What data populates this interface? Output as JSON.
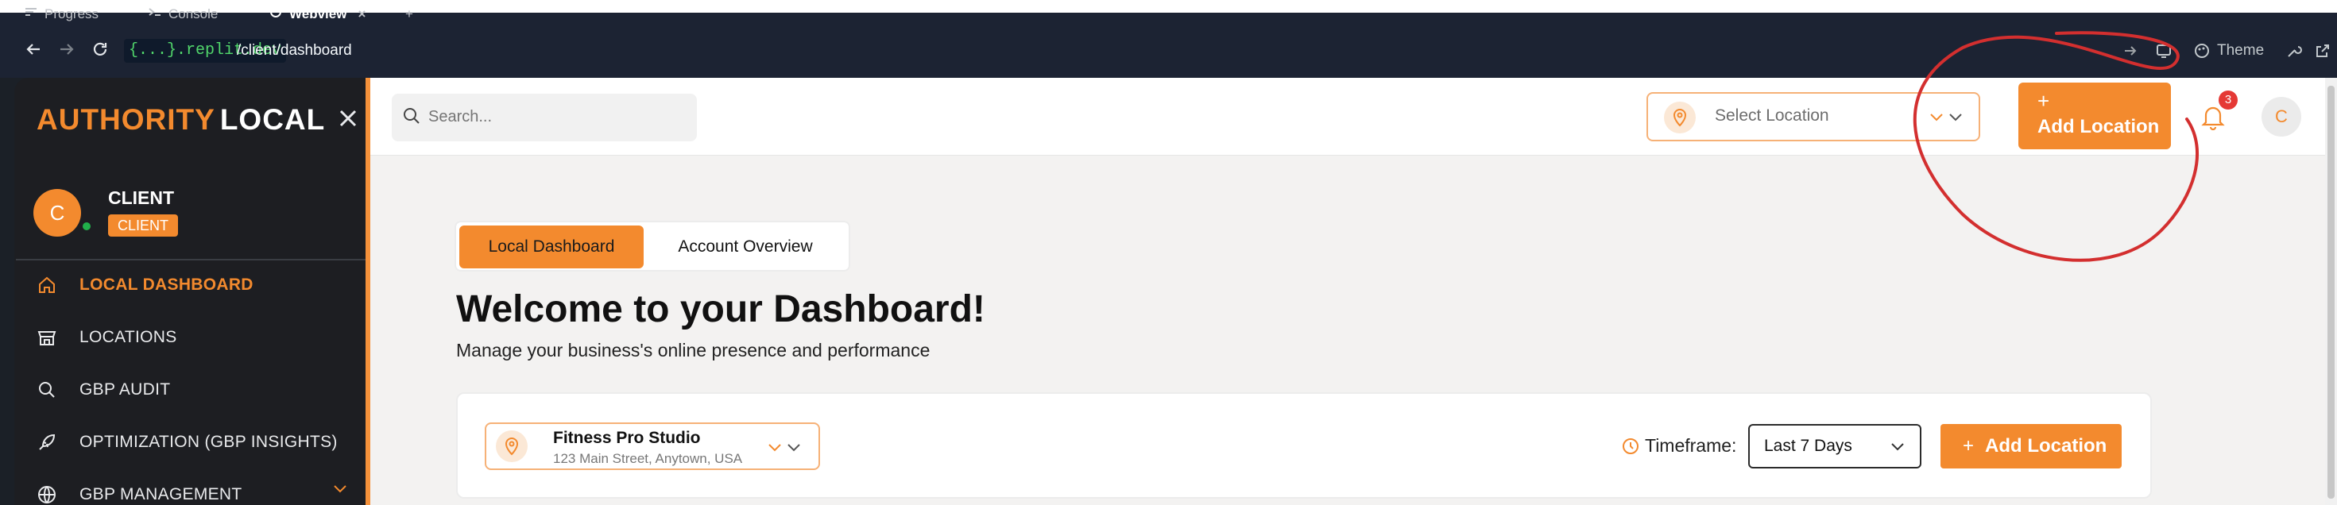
{
  "ide": {
    "tabs": [
      {
        "label": "Progress",
        "active": false
      },
      {
        "label": "Console",
        "active": false
      },
      {
        "label": "Webview",
        "active": true
      }
    ],
    "tab_close": "×",
    "tab_add": "+",
    "url_host": "{...}.replit.dev",
    "url_path": "/client/dashboard",
    "theme_label": "Theme"
  },
  "sidebar": {
    "brand_part1": "AUTHORITY",
    "brand_part2": "LOCAL",
    "user_initial": "C",
    "user_name": "CLIENT",
    "role_badge": "CLIENT",
    "items": [
      {
        "label": "LOCAL DASHBOARD",
        "icon": "home-icon",
        "active": true
      },
      {
        "label": "LOCATIONS",
        "icon": "store-icon",
        "active": false
      },
      {
        "label": "GBP AUDIT",
        "icon": "search-icon",
        "active": false
      },
      {
        "label": "OPTIMIZATION (GBP INSIGHTS)",
        "icon": "rocket-icon",
        "active": false
      },
      {
        "label": "GBP MANAGEMENT",
        "icon": "globe-icon",
        "active": false
      }
    ]
  },
  "header": {
    "search_placeholder": "Search...",
    "select_location_placeholder": "Select Location",
    "add_location_plus": "+",
    "add_location_label": "Add Location",
    "notification_count": "3",
    "avatar_initial": "C"
  },
  "main": {
    "tabs": [
      {
        "label": "Local Dashboard",
        "active": true
      },
      {
        "label": "Account Overview",
        "active": false
      }
    ],
    "title": "Welcome to your Dashboard!",
    "subtitle": "Manage your business's online presence and performance",
    "business": {
      "name": "Fitness Pro Studio",
      "address": "123 Main Street, Anytown, USA"
    },
    "timeframe_label": "Timeframe:",
    "timeframe_value": "Last 7 Days",
    "add_location_label": "Add Location",
    "add_location_plus": "+"
  },
  "colors": {
    "accent": "#f38a2e",
    "sidebar_bg": "#1d1e22",
    "ide_bg": "#1c2333",
    "annotation": "#d32f2f",
    "badge": "#e53935"
  }
}
